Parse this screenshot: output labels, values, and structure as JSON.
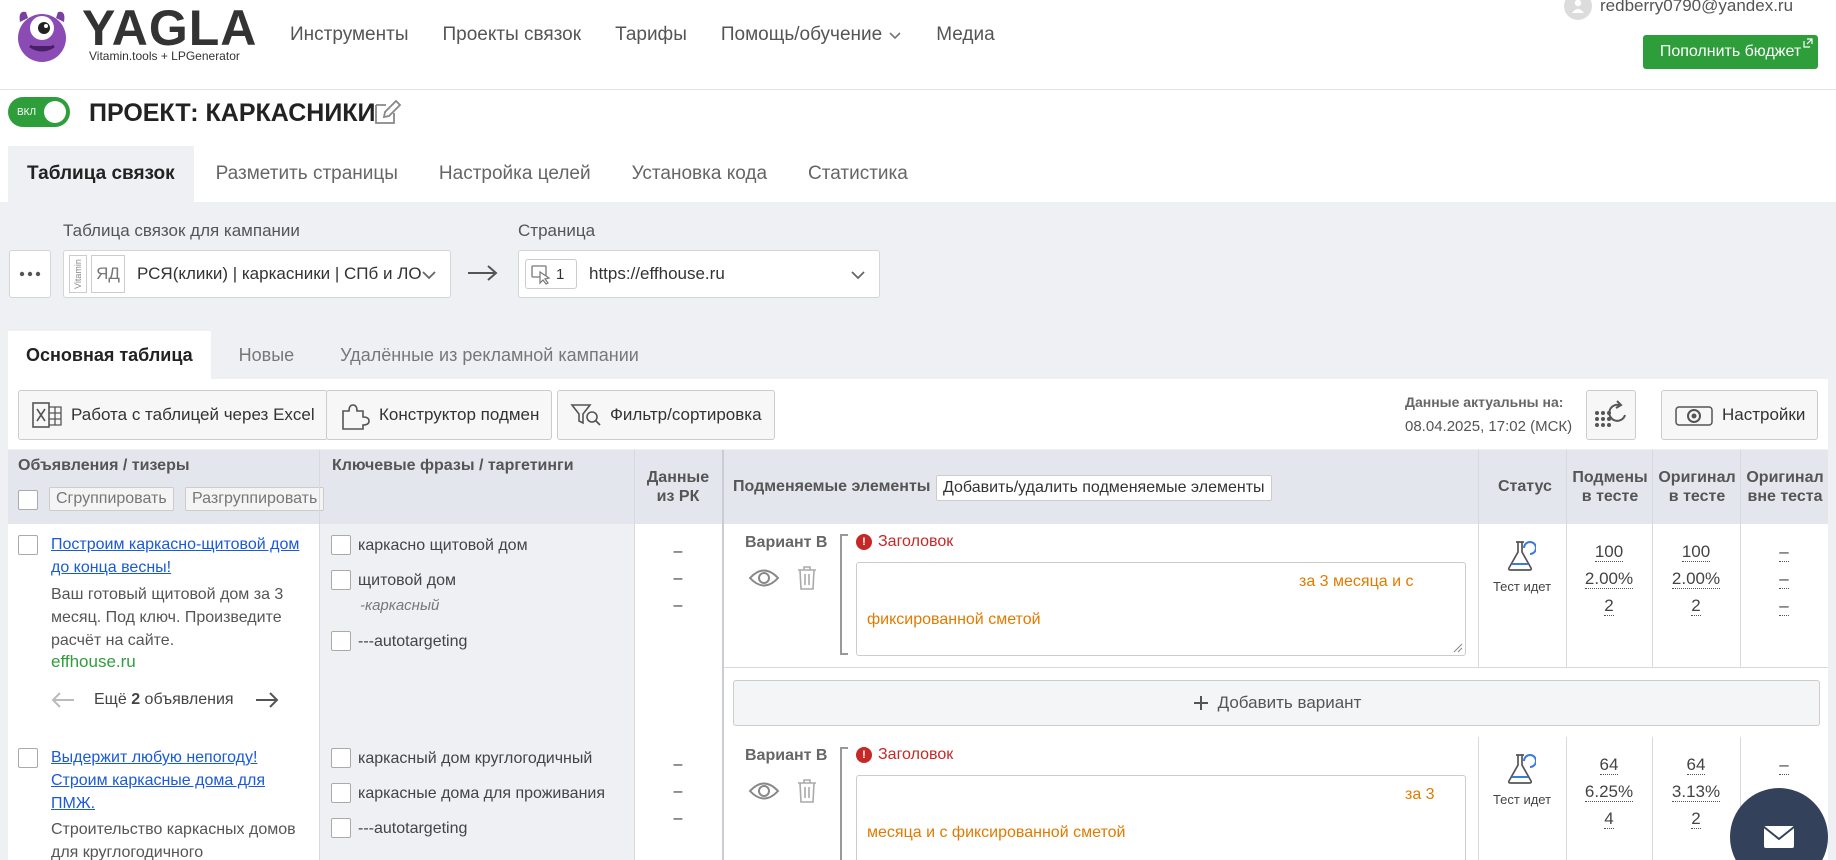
{
  "header": {
    "logo_text": "YAGLA",
    "logo_sub": "Vitamin.tools + LPGenerator",
    "nav": [
      {
        "label": "Инструменты"
      },
      {
        "label": "Проекты связок"
      },
      {
        "label": "Тарифы"
      },
      {
        "label": "Помощь/обучение",
        "dropdown": true
      },
      {
        "label": "Медиа"
      }
    ],
    "user_email": "redberry0790@yandex.ru",
    "topup_label": "Пополнить бюджет"
  },
  "project": {
    "toggle_label": "ВКЛ",
    "toggle_on": true,
    "title": "ПРОЕКТ: КАРКАСНИКИ"
  },
  "tabs": [
    "Таблица связок",
    "Разметить страницы",
    "Настройка целей",
    "Установка кода",
    "Статистика"
  ],
  "selectors": {
    "campaign_label": "Таблица связок для кампании",
    "campaign_vitamin": "Vitamin",
    "campaign_tag": "ЯД",
    "campaign_value": "РСЯ(клики) | каркасники | СПб и ЛО",
    "page_label": "Страница",
    "page_count": "1",
    "page_value": "https://effhouse.ru"
  },
  "subtabs": [
    "Основная таблица",
    "Новые",
    "Удалённые из рекламной кампании"
  ],
  "toolbar": {
    "excel": "Работа с таблицей через Excel",
    "constructor": "Конструктор подмен",
    "filter": "Фильтр/сортировка",
    "data_actual_label": "Данные актуальны на:",
    "data_actual_value": "08.04.2025, 17:02 (МСК)",
    "settings": "Настройки"
  },
  "table": {
    "col_ads": "Объявления / тизеры",
    "group_btn": "Сгруппировать",
    "ungroup_btn": "Разгруппировать",
    "col_keywords": "Ключевые фразы / таргетинги",
    "col_data_rk_1": "Данные",
    "col_data_rk_2": "из РК",
    "col_replaced": "Подменяемые элементы",
    "add_remove_btn": "Добавить/удалить подменяемые элементы",
    "col_status": "Статус",
    "col_subs_1": "Подмены",
    "col_subs_2": "в тесте",
    "col_orig_1": "Оригинал",
    "col_orig_2": "в тесте",
    "col_orig_out_1": "Оригинал",
    "col_orig_out_2": "вне теста",
    "add_variant": "Добавить вариант",
    "rows": [
      {
        "ad_title_1": "Построим каркасно-щитовой дом",
        "ad_title_2": "до конца весны!",
        "ad_text_1": "Ваш готовый щитовой дом за 3",
        "ad_text_2": "месяц. Под ключ. Произведите",
        "ad_text_3": "расчёт на сайте.",
        "ad_domain": "effhouse.ru",
        "more_prefix": "Ещё",
        "more_count": "2",
        "more_suffix": "объявления",
        "keywords": [
          "каркасно щитовой дом",
          "щитовой дом",
          "---autotargeting"
        ],
        "keyword_minus": "-каркасный",
        "dashes": [
          "–",
          "–",
          "–"
        ],
        "variant": "Вариант B",
        "element": "Заголовок",
        "text_1": "за 3 месяца и с",
        "text_2": "фиксированной сметой",
        "status": "Тест идет",
        "subs": [
          "100",
          "2.00%",
          "2"
        ],
        "orig": [
          "100",
          "2.00%",
          "2"
        ],
        "orig_out": [
          "–",
          "–",
          "–"
        ]
      },
      {
        "ad_title_1": "Выдержит любую непогоду!",
        "ad_title_2": "Строим каркасные дома для",
        "ad_title_3": "ПМЖ.",
        "ad_text_1": "Строительство каркасных домов",
        "ad_text_2": "для круглогодичного",
        "keywords": [
          "каркасный дом круглогодичный",
          "каркасные дома для проживания",
          "---autotargeting"
        ],
        "dashes": [
          "–",
          "–",
          "–"
        ],
        "variant": "Вариант B",
        "element": "Заголовок",
        "text_1": "за 3",
        "text_2": "месяца и с фиксированной сметой",
        "status": "Тест идет",
        "subs": [
          "64",
          "6.25%",
          "4"
        ],
        "orig": [
          "64",
          "3.13%",
          "2"
        ],
        "orig_out": [
          "–"
        ]
      }
    ]
  }
}
